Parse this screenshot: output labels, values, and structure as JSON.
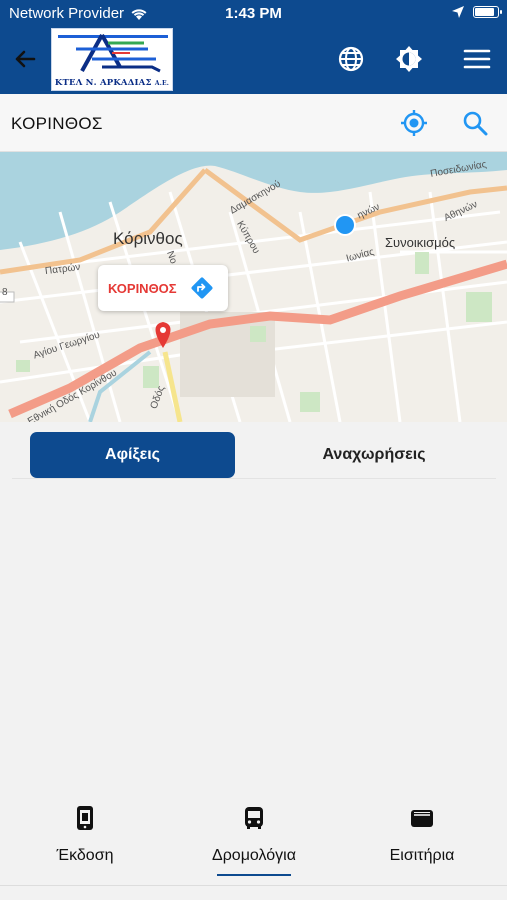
{
  "status_bar": {
    "carrier": "Network Provider",
    "time": "1:43 PM",
    "battery_level": 0.9
  },
  "header": {
    "logo_text": "ΚΤΕΛ Ν. ΑΡΚΑΔΙΑΣ",
    "logo_suffix": "Α.Ε.",
    "icons": [
      "back-arrow-icon",
      "globe-icon",
      "brightness-icon",
      "menu-icon"
    ],
    "background_color": "#0d4a8f"
  },
  "location": {
    "title": "ΚΟΡΙΝΘΟΣ",
    "icons": [
      "my-location-icon",
      "search-icon"
    ],
    "accent_color": "#2196f3"
  },
  "map": {
    "city": "Κόρινθος",
    "neighborhood": "Συνοικισμός",
    "streets": {
      "patron": "Πατρών",
      "damaskinou": "Δαμασκηνού",
      "kyprou": "Κύπρου",
      "ionias": "Ιωνίας",
      "athinon": "Αθηνών",
      "poseidonias": "Ποσειδωνίας",
      "agiou_georgiou": "Αγίου Γεωργίου",
      "korinthou": "Εθνική Οδός Κορίνθου",
      "odos": "Οδός",
      "no": "Νο",
      "ionias2": "ηνών",
      "route": "8"
    },
    "popup_label": "ΚΟΡΙΝΘΟΣ"
  },
  "tabs": {
    "arrivals": "Αφίξεις",
    "departures": "Αναχωρήσεις",
    "active": "arrivals"
  },
  "bottom_nav": {
    "items": [
      {
        "label": "Έκδοση",
        "icon": "ticket-issue-icon"
      },
      {
        "label": "Δρομολόγια",
        "icon": "bus-icon"
      },
      {
        "label": "Εισιτήρια",
        "icon": "wallet-icon"
      }
    ],
    "active_index": 1
  }
}
